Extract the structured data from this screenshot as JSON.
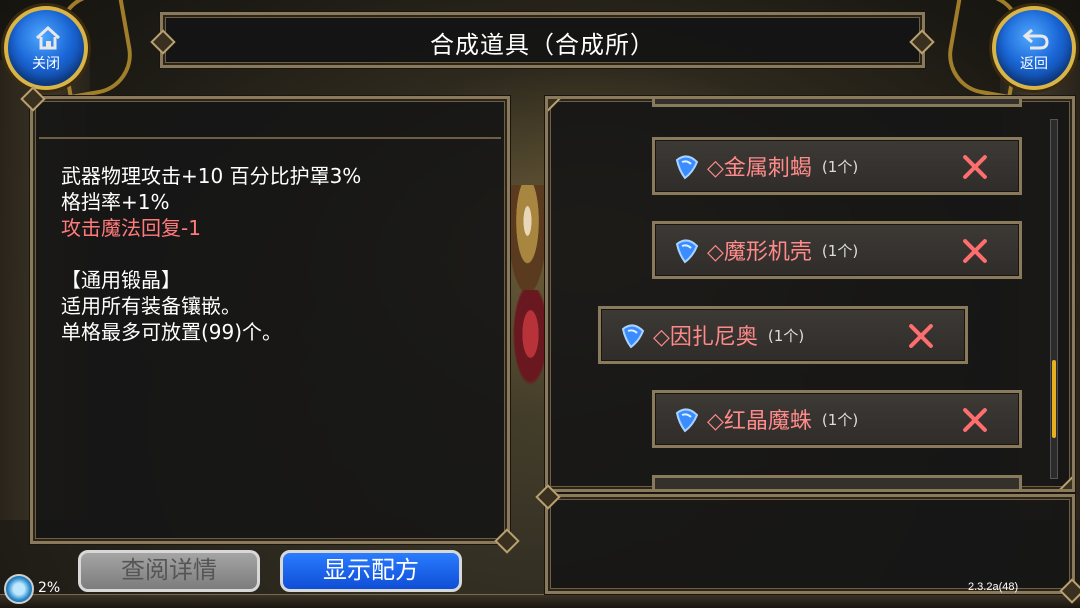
{
  "header": {
    "title": "合成道具（合成所）",
    "close_label": "关闭",
    "back_label": "返回"
  },
  "description": {
    "lines": [
      "武器物理攻击+10 百分比护罩3%",
      "格挡率+1%",
      "攻击魔法回复-1",
      "",
      "【通用锻晶】",
      "适用所有装备镶嵌。",
      "单格最多可放置(99)个。"
    ]
  },
  "materials": [
    {
      "name": "◇金属刺蝎",
      "qty": "(1个)"
    },
    {
      "name": "◇魔形机壳",
      "qty": "(1个)"
    },
    {
      "name": "◇因扎尼奥",
      "qty": "(1个)"
    },
    {
      "name": "◇红晶魔蛛",
      "qty": "(1个)"
    }
  ],
  "buttons": {
    "details": "查阅详情",
    "show_recipe": "显示配方"
  },
  "status": {
    "percent": "2%",
    "version": "2.3.2a(48)"
  },
  "colors": {
    "accent_gold": "#d9b446",
    "item_text": "#ff8a8a",
    "button_blue": "#1a66d6",
    "delete_red": "#ff6e6e"
  },
  "icons": {
    "close": "home-icon",
    "back": "return-arrow-icon",
    "material": "blue-crystal-icon",
    "remove": "close-x-icon"
  }
}
